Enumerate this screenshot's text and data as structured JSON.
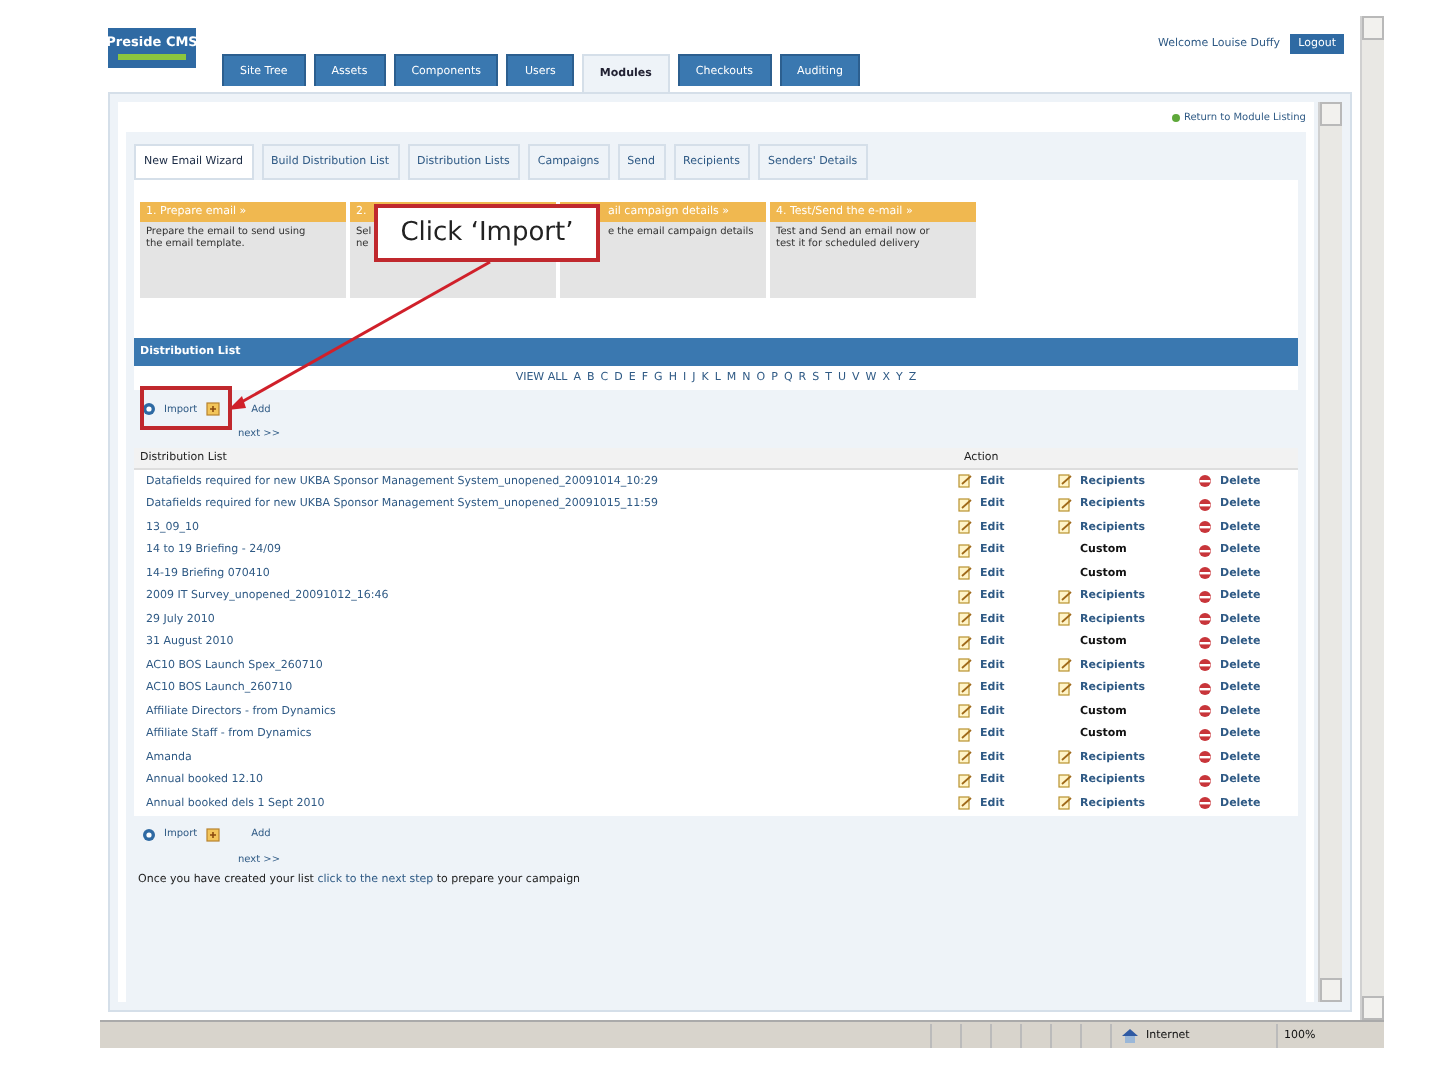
{
  "header": {
    "logo": "Preside CMS",
    "tabs": [
      {
        "label": "Site Tree",
        "selected": false
      },
      {
        "label": "Assets",
        "selected": false
      },
      {
        "label": "Components",
        "selected": false
      },
      {
        "label": "Users",
        "selected": false
      },
      {
        "label": "Modules",
        "selected": true
      },
      {
        "label": "Checkouts",
        "selected": false
      },
      {
        "label": "Auditing",
        "selected": false
      }
    ],
    "welcome": "Welcome Louise Duffy",
    "logout": "Logout"
  },
  "return_link": "Return to Module Listing",
  "subtabs": [
    {
      "label": "New Email Wizard",
      "selected": true
    },
    {
      "label": "Build Distribution List",
      "selected": false
    },
    {
      "label": "Distribution Lists",
      "selected": false
    },
    {
      "label": "Campaigns",
      "selected": false
    },
    {
      "label": "Send",
      "selected": false
    },
    {
      "label": "Recipients",
      "selected": false
    },
    {
      "label": "Senders' Details",
      "selected": false
    }
  ],
  "steps": [
    {
      "title": "1. Prepare email »",
      "body": [
        "Prepare the email to send using",
        "the email template."
      ]
    },
    {
      "title": "2.",
      "body": [
        "Sel",
        "ne"
      ]
    },
    {
      "title": "ail campaign details »",
      "body": [
        "e the email campaign details"
      ]
    },
    {
      "title": "4. Test/Send the e-mail »",
      "body": [
        "Test and Send an email now or",
        "test it for scheduled delivery"
      ]
    }
  ],
  "callout": "Click ‘Import’",
  "distribution_list": {
    "title": "Distribution List",
    "letters": [
      "VIEW ALL",
      "A",
      "B",
      "C",
      "D",
      "E",
      "F",
      "G",
      "H",
      "I",
      "J",
      "K",
      "L",
      "M",
      "N",
      "O",
      "P",
      "Q",
      "R",
      "S",
      "T",
      "U",
      "V",
      "W",
      "X",
      "Y",
      "Z"
    ],
    "toolbar_top": {
      "import": "Import",
      "add": "Add",
      "next": "next >>"
    },
    "columns": [
      "Distribution List",
      "Action"
    ],
    "rows": [
      {
        "name": "Datafields required for new UKBA Sponsor Management System_unopened_20091014_10:29",
        "edit": "Edit",
        "kind": "recipients",
        "list": "Recipients",
        "delete": "Delete"
      },
      {
        "name": "Datafields required for new UKBA Sponsor Management System_unopened_20091015_11:59",
        "edit": "Edit",
        "kind": "recipients",
        "list": "Recipients",
        "delete": "Delete"
      },
      {
        "name": "13_09_10",
        "edit": "Edit",
        "kind": "recipients",
        "list": "Recipients",
        "delete": "Delete"
      },
      {
        "name": "14 to 19 Briefing - 24/09",
        "edit": "Edit",
        "kind": "custom",
        "list": "Custom",
        "delete": "Delete"
      },
      {
        "name": "14-19 Briefing 070410",
        "edit": "Edit",
        "kind": "custom",
        "list": "Custom",
        "delete": "Delete"
      },
      {
        "name": "2009 IT Survey_unopened_20091012_16:46",
        "edit": "Edit",
        "kind": "recipients",
        "list": "Recipients",
        "delete": "Delete"
      },
      {
        "name": "29 July 2010",
        "edit": "Edit",
        "kind": "recipients",
        "list": "Recipients",
        "delete": "Delete"
      },
      {
        "name": "31 August 2010",
        "edit": "Edit",
        "kind": "custom",
        "list": "Custom",
        "delete": "Delete"
      },
      {
        "name": "AC10 BOS Launch Spex_260710",
        "edit": "Edit",
        "kind": "recipients",
        "list": "Recipients",
        "delete": "Delete"
      },
      {
        "name": "AC10 BOS Launch_260710",
        "edit": "Edit",
        "kind": "recipients",
        "list": "Recipients",
        "delete": "Delete"
      },
      {
        "name": "Affiliate Directors - from Dynamics",
        "edit": "Edit",
        "kind": "custom",
        "list": "Custom",
        "delete": "Delete"
      },
      {
        "name": "Affiliate Staff - from Dynamics",
        "edit": "Edit",
        "kind": "custom",
        "list": "Custom",
        "delete": "Delete"
      },
      {
        "name": "Amanda",
        "edit": "Edit",
        "kind": "recipients",
        "list": "Recipients",
        "delete": "Delete"
      },
      {
        "name": "Annual booked 12.10",
        "edit": "Edit",
        "kind": "recipients",
        "list": "Recipients",
        "delete": "Delete"
      },
      {
        "name": "Annual booked dels 1 Sept 2010",
        "edit": "Edit",
        "kind": "recipients",
        "list": "Recipients",
        "delete": "Delete"
      }
    ],
    "toolbar_bottom": {
      "import": "Import",
      "add": "Add",
      "next": "next >>"
    },
    "note": {
      "before": "Once you have created your list",
      "link": "click to the next step",
      "after": "to prepare your campaign"
    }
  },
  "status_bar": {
    "zone": "Internet",
    "zoom": "100%"
  }
}
